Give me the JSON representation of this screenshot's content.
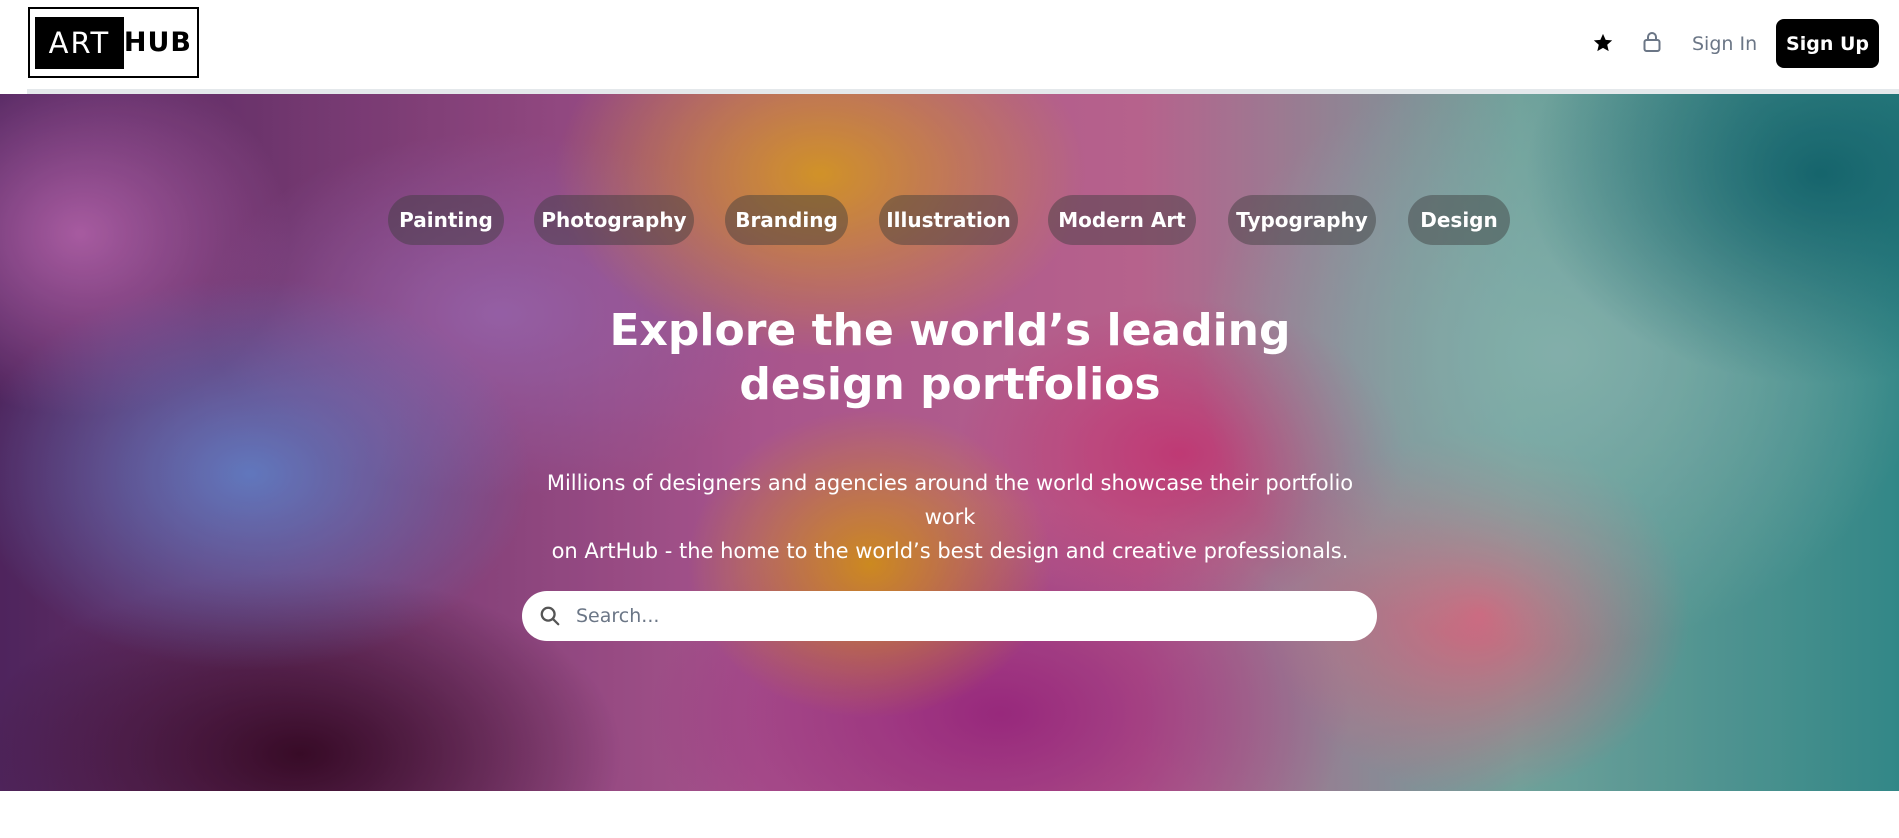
{
  "header": {
    "logo": {
      "left_text": "ART",
      "right_text": "HUB"
    },
    "icons": {
      "favorites": "star-icon",
      "lock": "lock-icon"
    },
    "sign_in_label": "Sign In",
    "sign_up_label": "Sign Up"
  },
  "hero": {
    "categories": [
      {
        "label": "Painting"
      },
      {
        "label": "Photography"
      },
      {
        "label": "Branding"
      },
      {
        "label": "Illustration"
      },
      {
        "label": "Modern Art"
      },
      {
        "label": "Typography"
      },
      {
        "label": "Design"
      }
    ],
    "headline_line1": "Explore the world’s leading",
    "headline_line2": "design portfolios",
    "subtext_line1": "Millions of designers and agencies around the world showcase their portfolio work",
    "subtext_line2": "on ArtHub - the home to the world’s best design and creative professionals.",
    "search": {
      "placeholder": "Search...",
      "value": ""
    }
  },
  "colors": {
    "brand": "#000000",
    "sign_up_bg": "#000000",
    "sign_in_text": "#6b7686",
    "tag_bg": "rgba(60,60,60,0.45)",
    "header_divider": "#e4e8eb"
  }
}
